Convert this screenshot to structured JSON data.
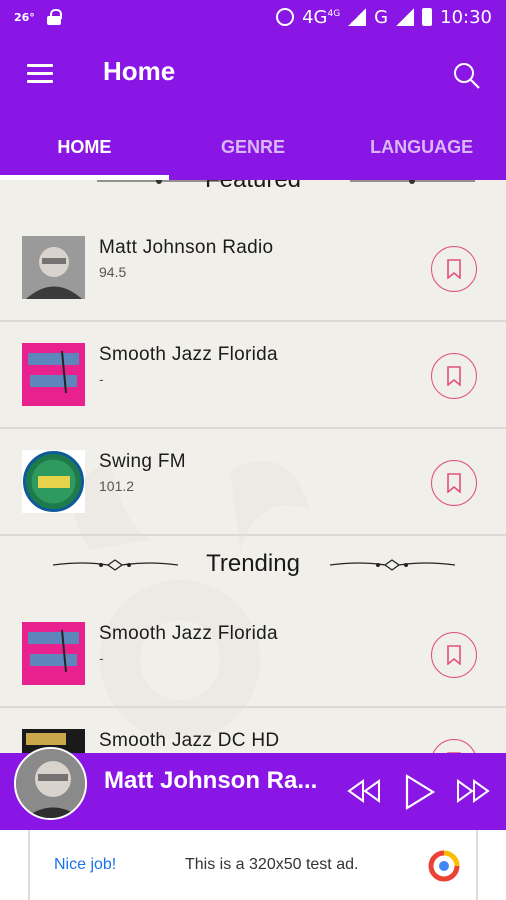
{
  "status_bar": {
    "temp": "26°",
    "network": "4G",
    "network_sup": "4G",
    "carrier": "G",
    "time": "10:30"
  },
  "app_bar": {
    "title": "Home"
  },
  "tabs": [
    {
      "label": "HOME",
      "active": true
    },
    {
      "label": "GENRE",
      "active": false
    },
    {
      "label": "LANGUAGE",
      "active": false
    }
  ],
  "sections": {
    "featured": {
      "title": "Featured",
      "items": [
        {
          "title": "Matt Johnson Radio",
          "subtitle": "94.5"
        },
        {
          "title": "Smooth Jazz Florida",
          "subtitle": "-"
        },
        {
          "title": "Swing FM",
          "subtitle": "101.2"
        }
      ]
    },
    "trending": {
      "title": "Trending",
      "items": [
        {
          "title": "Smooth Jazz Florida",
          "subtitle": "-"
        },
        {
          "title": "Smooth Jazz DC HD",
          "subtitle": ""
        }
      ]
    }
  },
  "player": {
    "now_playing": "Matt Johnson Ra..."
  },
  "ad": {
    "label": "Nice job!",
    "text": "This is a 320x50 test ad."
  },
  "colors": {
    "primary": "#8a16e6",
    "accent": "#e0517c",
    "background": "#f1efea"
  }
}
